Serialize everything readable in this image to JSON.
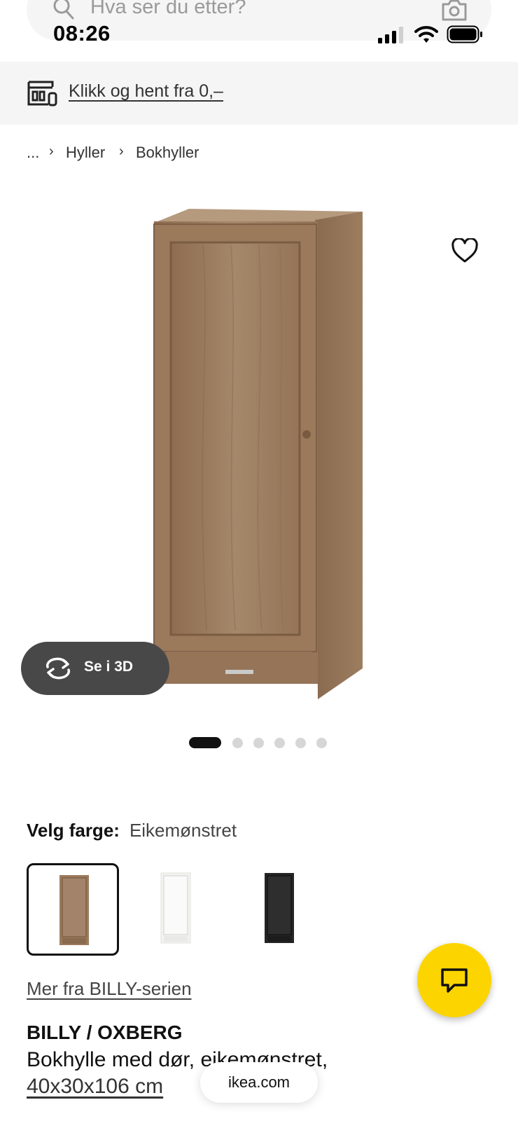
{
  "status_bar": {
    "time": "08:26"
  },
  "search": {
    "placeholder": "Hva ser du etter?"
  },
  "banner": {
    "link_label": "Klikk og hent fra 0,–"
  },
  "breadcrumb": {
    "items": [
      "...",
      "Hyller",
      "Bokhyller"
    ]
  },
  "gallery": {
    "view_3d_label": "Se i 3D",
    "slide_count": 6,
    "active_slide": 1
  },
  "colour": {
    "label": "Velg farge:",
    "selected_value": "Eikemønstret",
    "options": [
      {
        "name": "oak",
        "color": "#9b7a5c",
        "selected": true
      },
      {
        "name": "white",
        "color": "#f6f6f4",
        "selected": false
      },
      {
        "name": "black",
        "color": "#252525",
        "selected": false
      }
    ]
  },
  "series_link": "Mer fra BILLY-serien",
  "product": {
    "name": "BILLY / OXBERG",
    "description": "Bokhylle med dør, eikemønstret,",
    "size": "40x30x106 cm"
  },
  "browser": {
    "domain": "ikea.com"
  },
  "colors": {
    "chat_fab": "#fcd500",
    "banner_bg": "#f5f5f5",
    "button_3d_bg": "#484848"
  }
}
